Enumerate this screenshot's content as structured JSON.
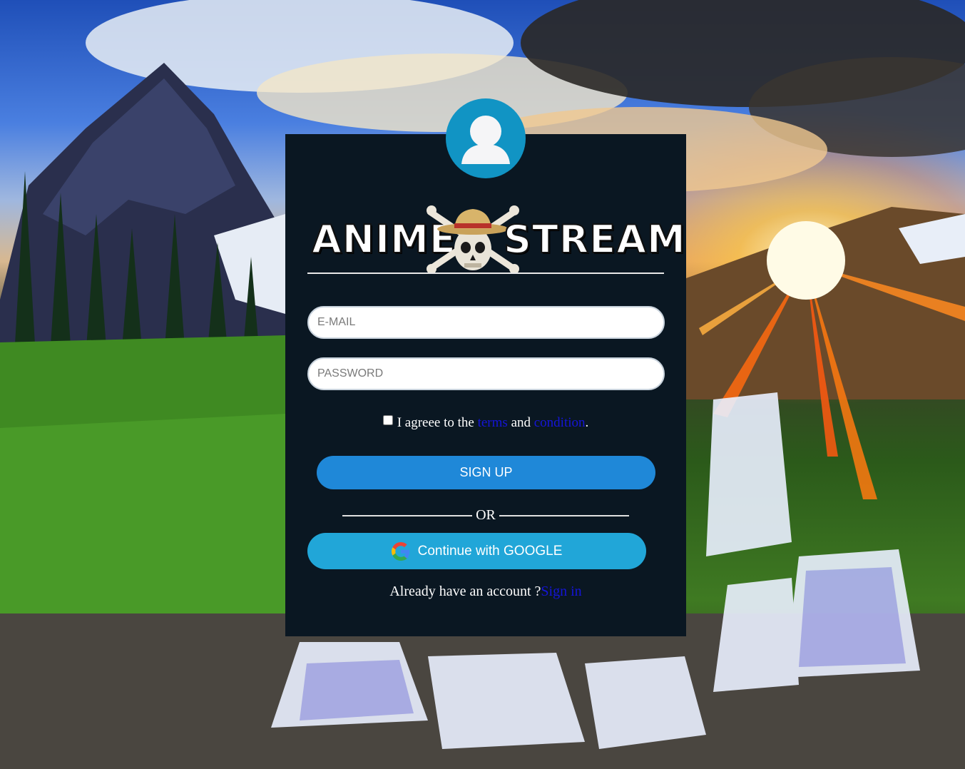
{
  "background": {
    "description_icon": "mountain-waterfall-sunset-background"
  },
  "avatar": {
    "icon": "user-silhouette-icon"
  },
  "brand": {
    "logo_word_left": "ANIME",
    "logo_word_right": "STREAM",
    "logo_emblem_icon": "straw-hat-skull-crossbones-icon"
  },
  "form": {
    "email_placeholder": "E-MAIL",
    "email_value": "",
    "password_placeholder": "PASSWORD",
    "password_value": "",
    "terms_prefix": "I agreee to the",
    "terms_link": "terms",
    "terms_and": "and",
    "condition_link": "condition",
    "terms_suffix": ".",
    "terms_checked": false,
    "signup_label": "SIGN UP",
    "or_label": "OR",
    "google_label": "Continue with GOOGLE",
    "google_icon": "google-g-icon",
    "signin_prompt": "Already have an account ?",
    "signin_link": "Sign in"
  },
  "colors": {
    "card_bg": "#0a1722",
    "avatar_bg": "#1194c4",
    "signup_btn": "#1f88d8",
    "google_btn": "#21a6d8",
    "link": "#1515d9"
  }
}
